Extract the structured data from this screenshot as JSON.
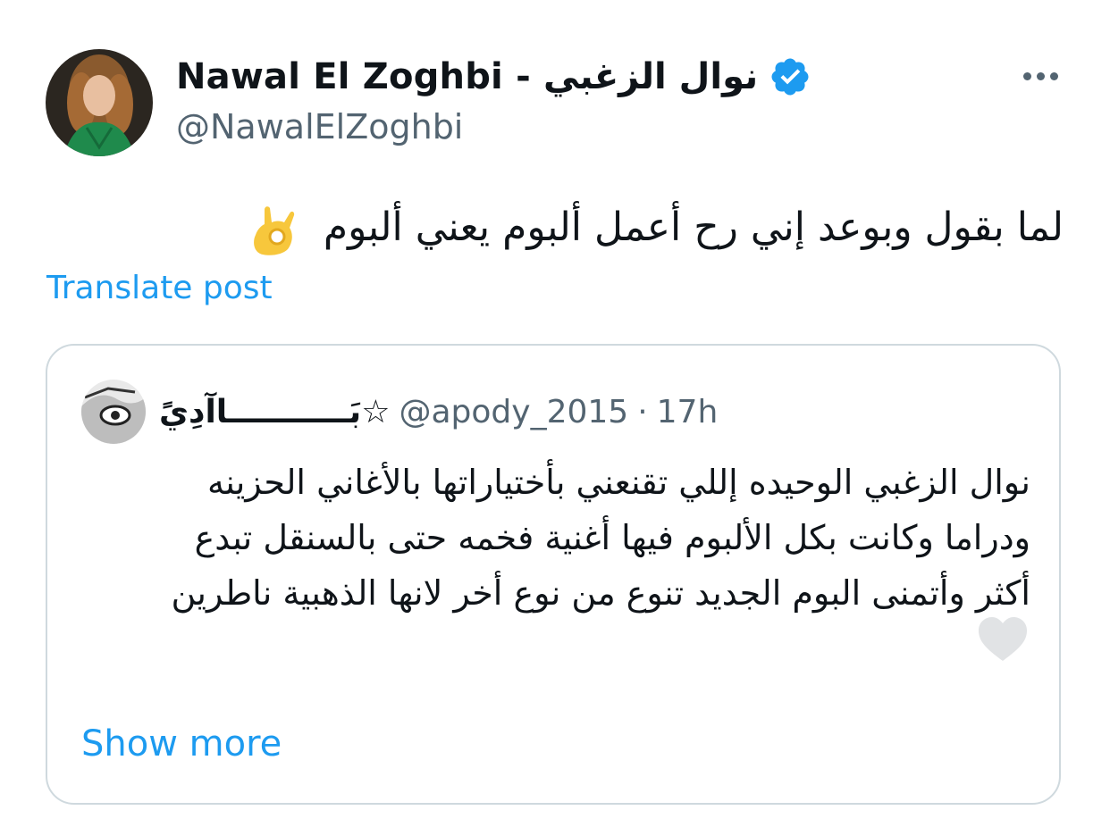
{
  "tweet": {
    "author": {
      "display_name": "Nawal El Zoghbi - نوال الزغبي",
      "handle": "@NawalElZoghbi",
      "verified": true
    },
    "text": "لما بقول وبوعد إني رح أعمل ألبوم يعني ألبوم",
    "emoji_icon": "ok-hand-emoji",
    "translate_label": "Translate post"
  },
  "quote": {
    "author": {
      "display_name": "☆بَـــــــــــاآدِيً",
      "handle": "@apody_2015",
      "separator": "·",
      "time": "17h"
    },
    "lines": [
      "نوال الزغبي الوحيده إللي تقنعني بأختياراتها بالأغاني الحزينه",
      "ودراما وكانت بكل الألبوم فيها أغنية فخمه حتى بالسنقل تبدع",
      "أكثر وأتمنى البوم الجديد تنوع من نوع أخر لانها الذهبية ناطرين"
    ],
    "heart_icon": "heart-icon",
    "show_more_label": "Show more"
  },
  "colors": {
    "accent": "#1d9bf0",
    "secondary_text": "#536471",
    "border": "#cfd9de"
  }
}
